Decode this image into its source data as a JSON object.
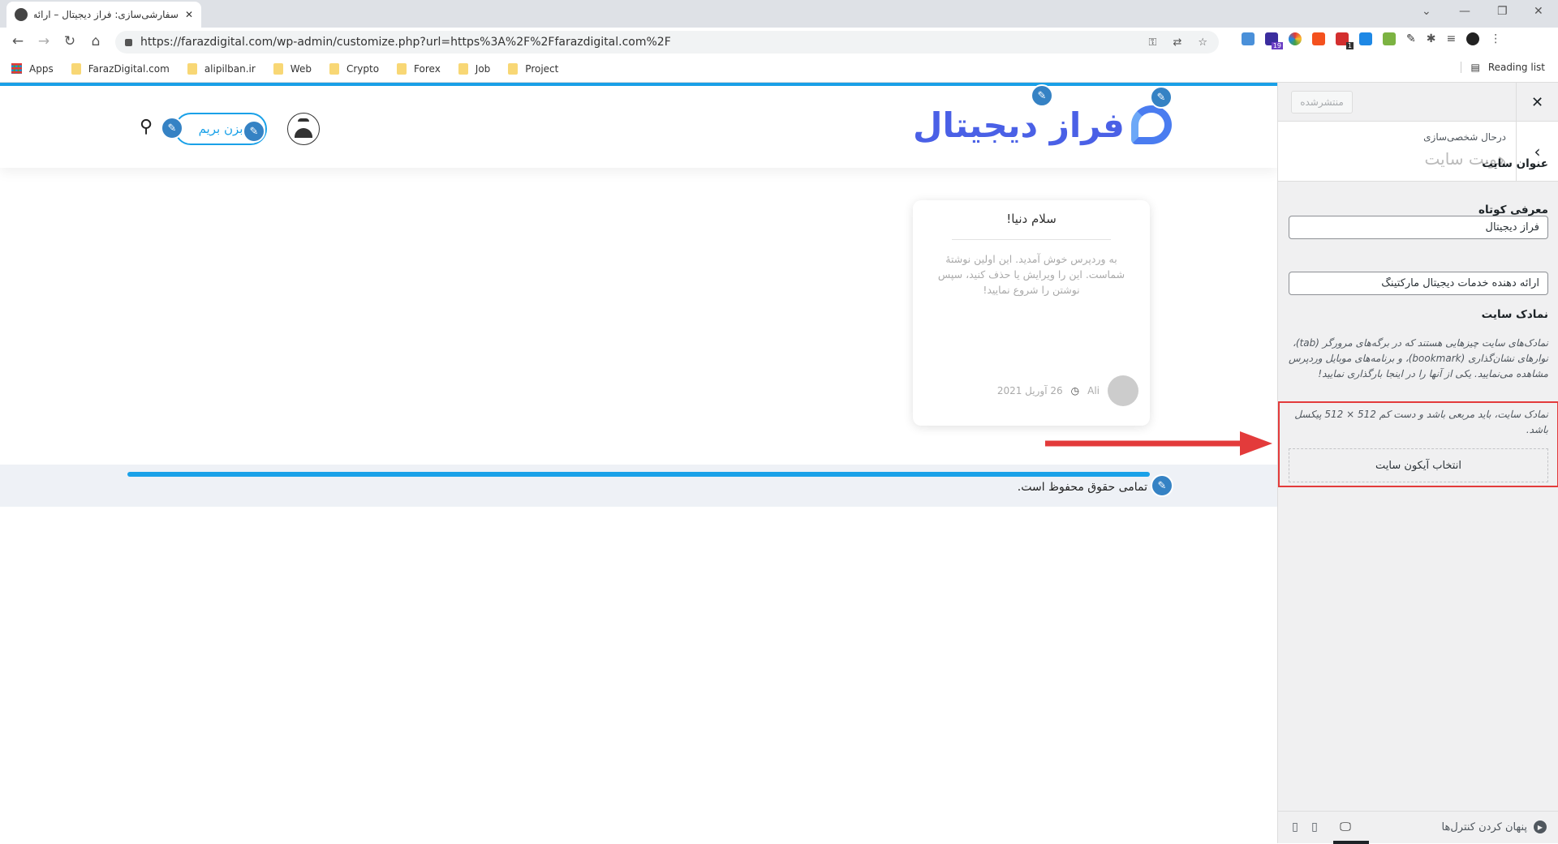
{
  "browser": {
    "tab_title": "سفارشی‌سازی: فراز دیجیتال – ارائه د",
    "url": "https://farazdigital.com/wp-admin/customize.php?url=https%3A%2F%2Ffarazdigital.com%2F",
    "bookmarks": [
      {
        "label": "Apps"
      },
      {
        "label": "FarazDigital.com"
      },
      {
        "label": "alipilban.ir"
      },
      {
        "label": "Web"
      },
      {
        "label": "Crypto"
      },
      {
        "label": "Forex"
      },
      {
        "label": "Job"
      },
      {
        "label": "Project"
      }
    ],
    "reading_list": "Reading list",
    "extension_badges": {
      "ext2": "19",
      "ext5": "1"
    }
  },
  "site": {
    "logo_text": "فراز دیجیتال",
    "cta_label": "بزن بریم",
    "post": {
      "title": "سلام دنیا!",
      "excerpt": "به وردپرس خوش آمدید. این اولین نوشتهٔ شماست. این را ویرایش یا حذف کنید، سپس نوشتن را شروع نمایید!",
      "author": "Ali",
      "date": "26 آوریل 2021"
    },
    "footer_text": "تمامی حقوق محفوظ است.",
    "accent": "#1aa1e8"
  },
  "customizer": {
    "publish_label": "منتشرشده",
    "breadcrumb": "درحال شخصی‌سازی",
    "section_title": "هویت سایت",
    "site_title_label": "عنوان سایت",
    "site_title_value": "فراز دیجیتال",
    "tagline_label": "معرفی کوتاه",
    "tagline_value": "ارائه دهنده خدمات دیجیتال مارکتینگ",
    "site_icon_label": "نمادک سایت",
    "site_icon_desc": "نمادک‌های سایت چیزهایی هستند که در برگه‌های مرورگر (tab)، نوارهای نشان‌گذاری (bookmark)، و برنامه‌های موبایل وردپرس مشاهده می‌نمایید. یکی از آنها را در اینجا بارگذاری نمایید!",
    "site_icon_hint": "نمادک سایت، باید مربعی باشد و دست کم 512 × 512 پیکسل باشد.",
    "select_icon_label": "انتخاب آیکون سایت",
    "hide_controls_label": "پنهان کردن کنترل‌ها",
    "highlight_color": "#e33b3b"
  }
}
